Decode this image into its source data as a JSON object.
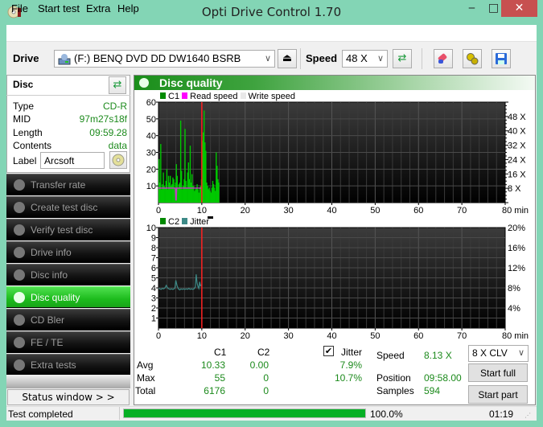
{
  "window": {
    "title": "Opti Drive Control 1.70",
    "minimize_glyph": "‒",
    "maximize_glyph": "□",
    "close_glyph": "✕"
  },
  "menu": [
    "File",
    "Start test",
    "Extra",
    "Help"
  ],
  "toolbar": {
    "drive_label": "Drive",
    "drive_value": "(F:)  BENQ DVD DD DW1640 BSRB",
    "eject_glyph": "⏏",
    "speed_label": "Speed",
    "speed_value": "48 X",
    "refresh_glyph": "⇄",
    "chevron": "∨"
  },
  "disc": {
    "header": "Disc",
    "fields": [
      {
        "key": "Type",
        "value": "CD-R"
      },
      {
        "key": "MID",
        "value": "97m27s18f"
      },
      {
        "key": "Length",
        "value": "09:59.28"
      },
      {
        "key": "Contents",
        "value": "data"
      }
    ],
    "label_key": "Label",
    "label_value": "Arcsoft"
  },
  "nav": [
    {
      "label": "Transfer rate",
      "active": false
    },
    {
      "label": "Create test disc",
      "active": false
    },
    {
      "label": "Verify test disc",
      "active": false
    },
    {
      "label": "Drive info",
      "active": false
    },
    {
      "label": "Disc info",
      "active": false
    },
    {
      "label": "Disc quality",
      "active": true
    },
    {
      "label": "CD Bler",
      "active": false
    },
    {
      "label": "FE / TE",
      "active": false
    },
    {
      "label": "Extra tests",
      "active": false
    }
  ],
  "status_window_button": "Status window > >",
  "panel_title": "Disc quality",
  "colors": {
    "c1": "#00c800",
    "read_speed": "#ff00ff",
    "write_speed": "#e8e8e8",
    "c2": "#00a000",
    "jitter": "#3d8a87",
    "position_marker": "#ff2020",
    "accent_green": "#1dbb1d",
    "value_green": "#1c8a1c"
  },
  "chart_data": [
    {
      "type": "bar",
      "title": "C1 / Read speed",
      "legend": [
        "C1",
        "Read speed",
        "Write speed"
      ],
      "legend_position": "top-left",
      "xlabel": "min",
      "x_ticks": [
        "0",
        "10",
        "20",
        "30",
        "40",
        "50",
        "60",
        "70",
        "80 min"
      ],
      "xlim": [
        0,
        80
      ],
      "y_ticks_left": [
        "10",
        "20",
        "30",
        "40",
        "50",
        "60"
      ],
      "ylim_left": [
        0,
        60
      ],
      "y_ticks_right": [
        "8 X",
        "16 X",
        "24 X",
        "32 X",
        "40 X",
        "48 X"
      ],
      "ylim_right": [
        0,
        56
      ],
      "grid": true,
      "position_marker_min": 10,
      "c1_series": {
        "x_step_min": 0.2,
        "values": [
          26,
          12,
          35,
          8,
          11,
          18,
          10,
          9,
          13,
          20,
          8,
          16,
          12,
          16,
          10,
          11,
          15,
          14,
          9,
          12,
          23,
          16,
          9,
          11,
          12,
          49,
          19,
          8,
          10,
          14,
          44,
          13,
          9,
          18,
          24,
          14,
          34,
          12,
          17,
          10,
          10,
          7,
          8,
          9,
          11,
          8,
          6,
          9,
          10,
          14,
          37,
          42,
          55,
          36,
          31,
          12,
          10,
          8,
          9,
          7,
          6,
          9,
          13,
          11,
          9,
          7,
          30,
          22,
          14,
          12
        ]
      },
      "read_speed_series": {
        "x": [
          0,
          3.9,
          4.0,
          4.1,
          4.2,
          10
        ],
        "values": [
          8.1,
          8.1,
          1.5,
          1.5,
          8.1,
          8.1
        ]
      }
    },
    {
      "type": "line",
      "title": "C2 / Jitter",
      "legend": [
        "C2",
        "Jitter"
      ],
      "legend_position": "top-left",
      "xlabel": "min",
      "x_ticks": [
        "0",
        "10",
        "20",
        "30",
        "40",
        "50",
        "60",
        "70",
        "80 min"
      ],
      "xlim": [
        0,
        80
      ],
      "y_ticks_left": [
        "1",
        "2",
        "3",
        "4",
        "5",
        "6",
        "7",
        "8",
        "9",
        "10"
      ],
      "ylim_left": [
        0,
        10
      ],
      "y_ticks_right": [
        "4%",
        "8%",
        "12%",
        "16%",
        "20%"
      ],
      "ylim_right": [
        0,
        20
      ],
      "grid": true,
      "position_marker_min": 10,
      "c2_values": [],
      "jitter_series_percent": {
        "x": [
          0,
          0.3,
          0.6,
          0.9,
          1.2,
          1.5,
          1.8,
          2.1,
          2.4,
          2.7,
          3.0,
          3.3,
          3.6,
          3.8,
          4.0,
          4.3,
          4.6,
          4.9,
          5.2,
          5.5,
          5.8,
          6.1,
          6.4,
          6.7,
          7.0,
          7.3,
          7.6,
          7.9,
          8.2,
          8.5,
          8.7,
          8.9,
          9.1,
          9.3,
          9.5,
          9.7,
          9.9
        ],
        "values": [
          7.9,
          7.8,
          7.7,
          7.9,
          7.8,
          8.0,
          8.5,
          8.0,
          7.8,
          7.7,
          7.8,
          7.7,
          7.8,
          8.0,
          9.5,
          8.4,
          7.8,
          7.6,
          7.8,
          7.7,
          7.8,
          7.7,
          7.8,
          7.7,
          7.9,
          7.7,
          7.8,
          7.7,
          7.8,
          8.2,
          10.7,
          9.0,
          8.3,
          7.9,
          9.2,
          8.4,
          8.6
        ]
      }
    }
  ],
  "stats": {
    "col_c1": "C1",
    "col_c2": "C2",
    "jitter_label": "Jitter",
    "jitter_checked": true,
    "rows": [
      {
        "label": "Avg",
        "c1": "10.33",
        "c2": "0.00",
        "jitter": "7.9%"
      },
      {
        "label": "Max",
        "c1": "55",
        "c2": "0",
        "jitter": "10.7%"
      },
      {
        "label": "Total",
        "c1": "6176",
        "c2": "0",
        "jitter": ""
      }
    ],
    "speed_label": "Speed",
    "speed_value": "8.13 X",
    "position_label": "Position",
    "position_value": "09:58.00",
    "samples_label": "Samples",
    "samples_value": "594",
    "speed_mode": "8 X CLV",
    "start_full": "Start full",
    "start_part": "Start part"
  },
  "statusbar": {
    "text": "Test completed",
    "progress_percent": 100.0,
    "progress_text": "100.0%",
    "elapsed": "01:19"
  }
}
